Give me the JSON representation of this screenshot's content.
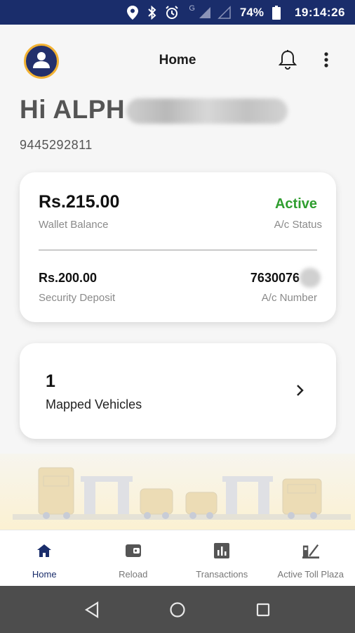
{
  "status_bar": {
    "network_label": "G",
    "battery_percent": "74%",
    "time": "19:14:26",
    "icons": [
      "location-icon",
      "bluetooth-icon",
      "alarm-icon",
      "signal-icon",
      "signal-empty-icon",
      "battery-icon"
    ]
  },
  "header": {
    "title": "Home",
    "avatar_icon": "user-icon",
    "notification_icon": "bell-icon",
    "menu_icon": "more-vertical-icon"
  },
  "user": {
    "greeting": "Hi ALPH",
    "phone": "9445292811"
  },
  "wallet": {
    "balance": "Rs.215.00",
    "balance_label": "Wallet Balance",
    "status": "Active",
    "status_label": "A/c Status",
    "security_deposit": "Rs.200.00",
    "security_deposit_label": "Security Deposit",
    "account_number": "7630076",
    "account_number_label": "A/c Number"
  },
  "vehicles": {
    "count": "1",
    "label": "Mapped Vehicles"
  },
  "bottom_nav": {
    "items": [
      {
        "label": "Home",
        "icon": "home-icon",
        "selected": true
      },
      {
        "label": "Reload",
        "icon": "wallet-icon",
        "selected": false
      },
      {
        "label": "Transactions",
        "icon": "bar-chart-icon",
        "selected": false
      },
      {
        "label": "Active Toll Plaza",
        "icon": "toll-gate-icon",
        "selected": false
      }
    ]
  },
  "colors": {
    "primary": "#1a2d6b",
    "accent": "#f2b233",
    "active_status": "#2f9e2f"
  }
}
